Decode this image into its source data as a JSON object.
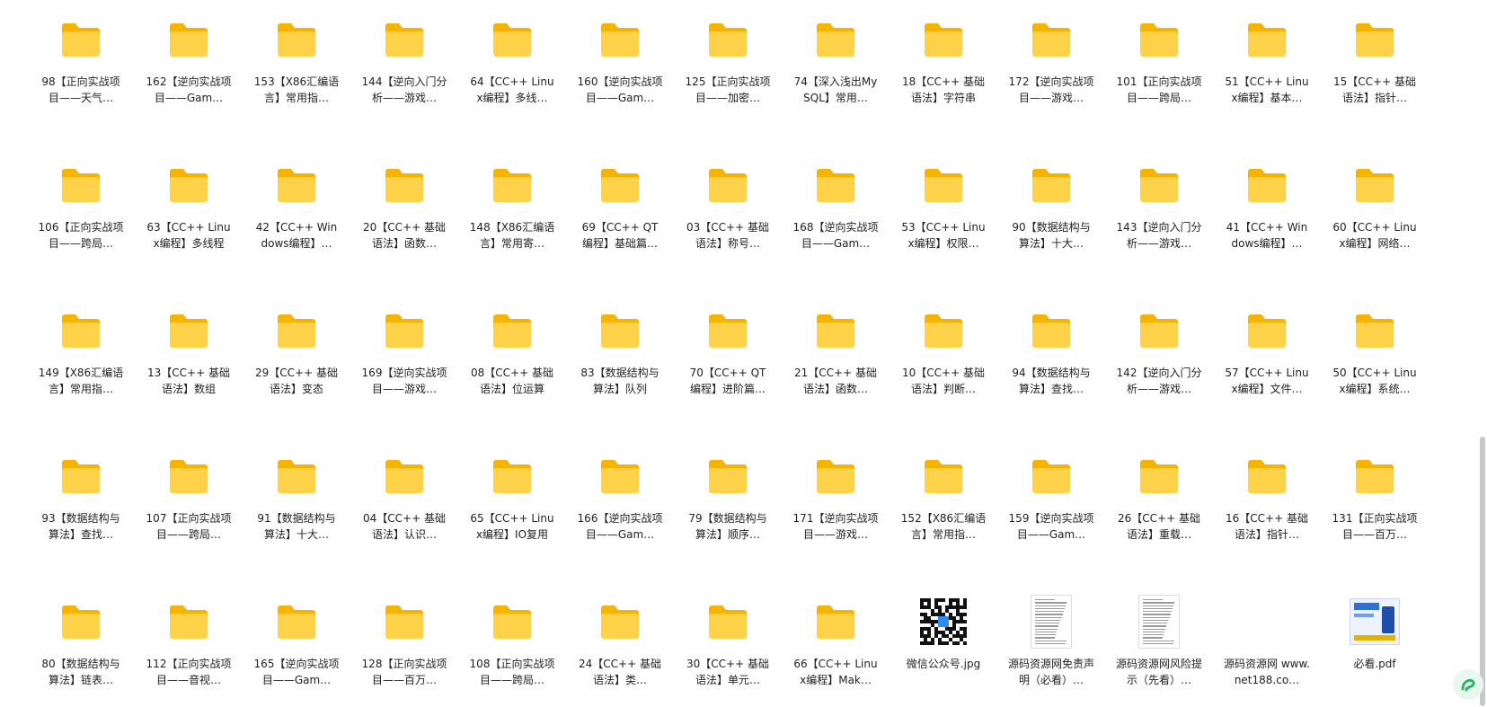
{
  "items": [
    {
      "type": "folder",
      "label": "98【正向实战项目——天气…"
    },
    {
      "type": "folder",
      "label": "162【逆向实战项目——Gam…"
    },
    {
      "type": "folder",
      "label": "153【X86汇编语言】常用指…"
    },
    {
      "type": "folder",
      "label": "144【逆向入门分析——游戏…"
    },
    {
      "type": "folder",
      "label": "64【CC++ Linux编程】多线…"
    },
    {
      "type": "folder",
      "label": "160【逆向实战项目——Gam…"
    },
    {
      "type": "folder",
      "label": "125【正向实战项目——加密…"
    },
    {
      "type": "folder",
      "label": "74【深入浅出MySQL】常用…"
    },
    {
      "type": "folder",
      "label": "18【CC++ 基础语法】字符串"
    },
    {
      "type": "folder",
      "label": "172【逆向实战项目——游戏…"
    },
    {
      "type": "folder",
      "label": "101【正向实战项目——跨局…"
    },
    {
      "type": "folder",
      "label": "51【CC++ Linux编程】基本…"
    },
    {
      "type": "folder",
      "label": "15【CC++ 基础语法】指针…"
    },
    {
      "type": "folder",
      "label": "106【正向实战项目——跨局…"
    },
    {
      "type": "folder",
      "label": "63【CC++ Linux编程】多线程"
    },
    {
      "type": "folder",
      "label": "42【CC++ Windows编程】…"
    },
    {
      "type": "folder",
      "label": "20【CC++ 基础语法】函数…"
    },
    {
      "type": "folder",
      "label": "148【X86汇编语言】常用寄…"
    },
    {
      "type": "folder",
      "label": "69【CC++ QT编程】基础篇…"
    },
    {
      "type": "folder",
      "label": "03【CC++ 基础语法】称号…"
    },
    {
      "type": "folder",
      "label": "168【逆向实战项目——Gam…"
    },
    {
      "type": "folder",
      "label": "53【CC++ Linux编程】权限…"
    },
    {
      "type": "folder",
      "label": "90【数据结构与算法】十大…"
    },
    {
      "type": "folder",
      "label": "143【逆向入门分析——游戏…"
    },
    {
      "type": "folder",
      "label": "41【CC++ Windows编程】…"
    },
    {
      "type": "folder",
      "label": "60【CC++ Linux编程】网络…"
    },
    {
      "type": "folder",
      "label": "149【X86汇编语言】常用指…"
    },
    {
      "type": "folder",
      "label": "13【CC++ 基础语法】数组"
    },
    {
      "type": "folder",
      "label": "29【CC++ 基础语法】变态"
    },
    {
      "type": "folder",
      "label": "169【逆向实战项目——游戏…"
    },
    {
      "type": "folder",
      "label": "08【CC++ 基础语法】位运算"
    },
    {
      "type": "folder",
      "label": "83【数据结构与算法】队列"
    },
    {
      "type": "folder",
      "label": "70【CC++ QT编程】进阶篇…"
    },
    {
      "type": "folder",
      "label": "21【CC++ 基础语法】函数…"
    },
    {
      "type": "folder",
      "label": "10【CC++ 基础语法】判断…"
    },
    {
      "type": "folder",
      "label": "94【数据结构与算法】查找…"
    },
    {
      "type": "folder",
      "label": "142【逆向入门分析——游戏…"
    },
    {
      "type": "folder",
      "label": "57【CC++ Linux编程】文件…"
    },
    {
      "type": "folder",
      "label": "50【CC++ Linux编程】系统…"
    },
    {
      "type": "folder",
      "label": "93【数据结构与算法】查找…"
    },
    {
      "type": "folder",
      "label": "107【正向实战项目——跨局…"
    },
    {
      "type": "folder",
      "label": "91【数据结构与算法】十大…"
    },
    {
      "type": "folder",
      "label": "04【CC++ 基础语法】认识…"
    },
    {
      "type": "folder",
      "label": "65【CC++ Linux编程】IO复用"
    },
    {
      "type": "folder",
      "label": "166【逆向实战项目——Gam…"
    },
    {
      "type": "folder",
      "label": "79【数据结构与算法】顺序…"
    },
    {
      "type": "folder",
      "label": "171【逆向实战项目——游戏…"
    },
    {
      "type": "folder",
      "label": "152【X86汇编语言】常用指…"
    },
    {
      "type": "folder",
      "label": "159【逆向实战项目——Gam…"
    },
    {
      "type": "folder",
      "label": "26【CC++ 基础语法】重载…"
    },
    {
      "type": "folder",
      "label": "16【CC++ 基础语法】指针…"
    },
    {
      "type": "folder",
      "label": "131【正向实战项目——百万…"
    },
    {
      "type": "folder",
      "label": "80【数据结构与算法】链表…"
    },
    {
      "type": "folder",
      "label": "112【正向实战项目——音视…"
    },
    {
      "type": "folder",
      "label": "165【逆向实战项目——Gam…"
    },
    {
      "type": "folder",
      "label": "128【正向实战项目——百万…"
    },
    {
      "type": "folder",
      "label": "108【正向实战项目——跨局…"
    },
    {
      "type": "folder",
      "label": "24【CC++ 基础语法】类…"
    },
    {
      "type": "folder",
      "label": "30【CC++ 基础语法】单元…"
    },
    {
      "type": "folder",
      "label": "66【CC++ Linux编程】Mak…"
    },
    {
      "type": "qr",
      "label": "微信公众号.jpg"
    },
    {
      "type": "doc",
      "label": "源码资源网免责声明（必看）…"
    },
    {
      "type": "doc",
      "label": "源码资源网风险提示（先看）…"
    },
    {
      "type": "blank",
      "label": "源码资源网 www.net188.co…"
    },
    {
      "type": "pdf",
      "label": "必看.pdf"
    }
  ],
  "colors": {
    "folder_back": "#F5B400",
    "folder_front": "#FFD24A",
    "scroll_thumb": "#C8C8C8"
  }
}
